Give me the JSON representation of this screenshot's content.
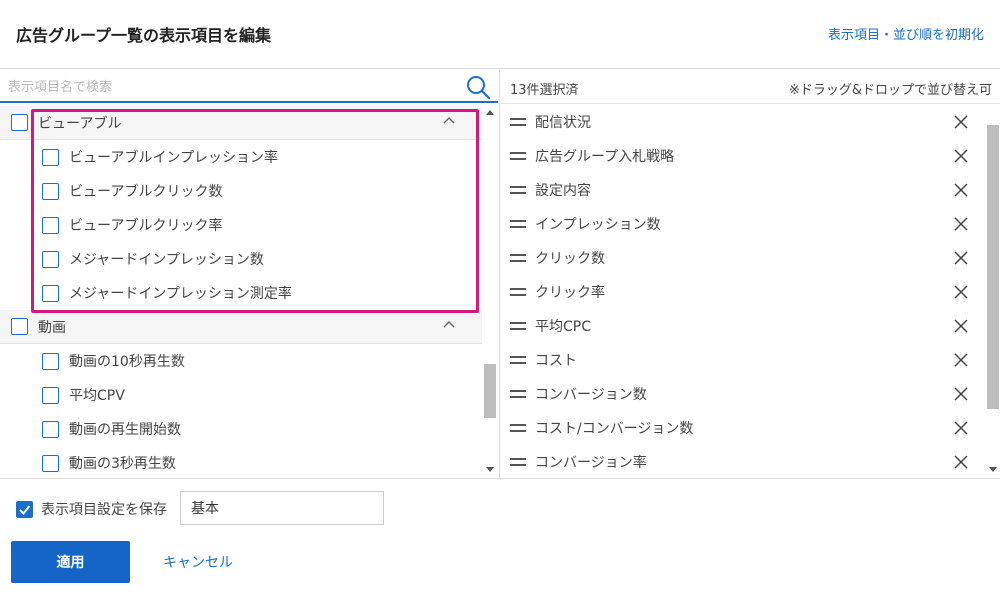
{
  "header": {
    "title": "広告グループ一覧の表示項目を編集",
    "reset_label": "表示項目・並び順を初期化"
  },
  "search": {
    "placeholder": "表示項目名で検索"
  },
  "groups": [
    {
      "label": "ビューアブル",
      "checked": false,
      "items": [
        {
          "label": "ビューアブルインプレッション率",
          "checked": false
        },
        {
          "label": "ビューアブルクリック数",
          "checked": false
        },
        {
          "label": "ビューアブルクリック率",
          "checked": false
        },
        {
          "label": "メジャードインプレッション数",
          "checked": false
        },
        {
          "label": "メジャードインプレッション測定率",
          "checked": false
        }
      ]
    },
    {
      "label": "動画",
      "checked": false,
      "items": [
        {
          "label": "動画の10秒再生数",
          "checked": false
        },
        {
          "label": "平均CPV",
          "checked": false
        },
        {
          "label": "動画の再生開始数",
          "checked": false
        },
        {
          "label": "動画の3秒再生数",
          "checked": false
        }
      ]
    }
  ],
  "selected": {
    "count_label": "13件選択済",
    "hint": "※ドラッグ&ドロップで並び替え可",
    "items": [
      "配信状況",
      "広告グループ入札戦略",
      "設定内容",
      "インプレッション数",
      "クリック数",
      "クリック率",
      "平均CPC",
      "コスト",
      "コンバージョン数",
      "コスト/コンバージョン数",
      "コンバージョン率"
    ]
  },
  "footer": {
    "save_label": "表示項目設定を保存",
    "save_checked": true,
    "preset_value": "基本",
    "apply_label": "適用",
    "cancel_label": "キャンセル"
  },
  "colors": {
    "accent": "#1a6fc9",
    "button": "#1565c8",
    "highlight": "#d4187c"
  },
  "icons": {
    "search": "search-icon",
    "caret": "chevron-up-icon",
    "drag": "drag-handle-icon",
    "remove": "close-icon",
    "check": "checkmark-icon"
  }
}
